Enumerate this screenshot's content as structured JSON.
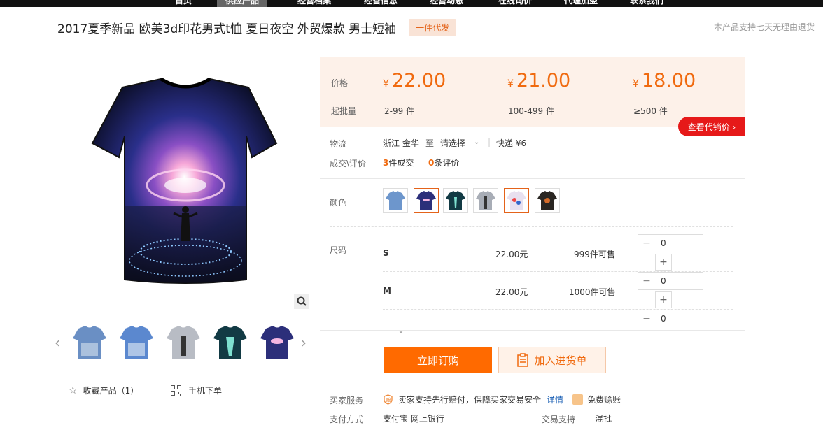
{
  "nav": {
    "tabs": [
      "首页",
      "供应产品",
      "经营档案",
      "经营信息",
      "经营动态",
      "在线询价",
      "代理加盟",
      "联系我们"
    ]
  },
  "product": {
    "title": "2017夏季新品 欧美3d印花男式t恤 夏日夜空 外贸爆款 男士短袖",
    "badge": "一件代发",
    "return_policy": "本产品支持七天无理由退货"
  },
  "gallery": {
    "main_image_icon": "galaxy-tshirt-image",
    "zoom_icon": "magnifier-icon",
    "prev_icon": "chevron-left-icon",
    "next_icon": "chevron-right-icon",
    "thumbnails": [
      "tshirt-city-blue",
      "tshirt-city-blue-2",
      "tshirt-tower-gray",
      "tshirt-galaxy-teal",
      "tshirt-galaxy-purple"
    ],
    "favorite_label": "收藏产品（1）",
    "mobile_order_label": "手机下单"
  },
  "pricing": {
    "price_label": "价格",
    "qty_label": "起批量",
    "tiers": [
      {
        "currency": "¥",
        "price": "22.00",
        "qty": "2-99 件"
      },
      {
        "currency": "¥",
        "price": "21.00",
        "qty": "100-499 件"
      },
      {
        "currency": "¥",
        "price": "18.00",
        "qty": "≥500 件"
      }
    ],
    "agent_price_button": "查看代销价 ›"
  },
  "logistics": {
    "label": "物流",
    "origin": "浙江 金华",
    "to": "至",
    "destination": "请选择",
    "express": "快递 ¥6"
  },
  "deals": {
    "label": "成交\\评价",
    "count": "3",
    "count_suffix": "件成交",
    "reviews": "0",
    "reviews_suffix": "条评价"
  },
  "colors": {
    "label": "颜色",
    "swatches": [
      {
        "name": "city-blue",
        "selected": false
      },
      {
        "name": "galaxy-purple",
        "selected": true
      },
      {
        "name": "galaxy-teal",
        "selected": false
      },
      {
        "name": "tower-gray",
        "selected": false
      },
      {
        "name": "colorful-splash",
        "selected": true
      },
      {
        "name": "dark-pattern",
        "selected": false
      }
    ]
  },
  "sizes": {
    "label": "尺码",
    "rows": [
      {
        "name": "S",
        "price": "22.00元",
        "stock": "999件可售",
        "qty": "0"
      },
      {
        "name": "M",
        "price": "22.00元",
        "stock": "1000件可售",
        "qty": "0"
      },
      {
        "name": "",
        "price": "",
        "stock": "",
        "qty": "0"
      }
    ]
  },
  "actions": {
    "order_now": "立即订购",
    "add_to_cart": "加入进货单"
  },
  "services": {
    "label": "买家服务",
    "text": "卖家支持先行赔付，保障买家交易安全",
    "details_link": "详情",
    "free_label": "免费赊账"
  },
  "payment": {
    "label": "支付方式",
    "methods": "支付宝  网上银行",
    "trade_label": "交易支持",
    "trade_value": "混批"
  },
  "colors_theme": {
    "accent": "#ff6a00",
    "price": "#f06a0f",
    "red": "#e61919"
  }
}
